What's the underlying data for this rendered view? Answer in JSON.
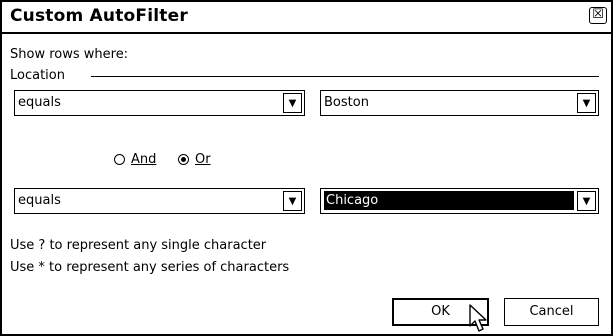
{
  "dialog": {
    "title": "Custom AutoFilter",
    "close_glyph": "☒"
  },
  "intro": "Show rows where:",
  "field_name": "Location",
  "criteria1": {
    "operator": "equals",
    "value": "Boston"
  },
  "logic": {
    "and_prefix": "",
    "and_label": "And",
    "or_label": "Or",
    "selected": "Or"
  },
  "criteria2": {
    "operator": "equals",
    "value": "Chicago"
  },
  "hints": [
    "Use ? to represent any single character",
    "Use * to represent any series of characters"
  ],
  "buttons": {
    "ok": "OK",
    "cancel": "Cancel"
  },
  "icons": {
    "dropdown": "chevron-down-icon",
    "cursor": "mouse-pointer-icon",
    "close": "close-icon"
  }
}
